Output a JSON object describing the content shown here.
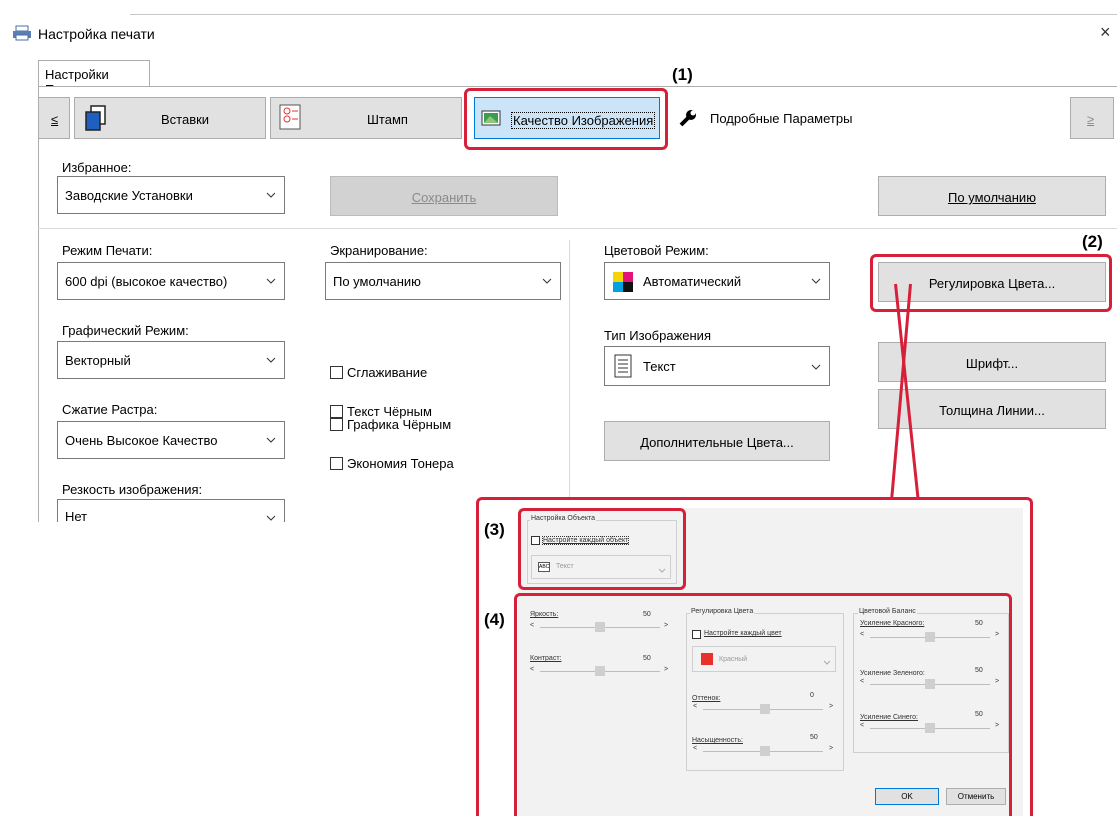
{
  "window": {
    "title": "Настройка печати",
    "close_glyph": "×"
  },
  "tab": {
    "label": "Настройки Печати"
  },
  "pager": {
    "prev": "≤",
    "next": "≥"
  },
  "page_buttons": [
    {
      "label": "Вставки",
      "icon": "inserts-icon"
    },
    {
      "label": "Штамп",
      "icon": "stamp-icon"
    },
    {
      "label": "Качество Изображения",
      "icon": "image-quality-icon"
    },
    {
      "label": "Подробные Параметры",
      "icon": "wrench-icon"
    }
  ],
  "favorites": {
    "label": "Избранное:",
    "value": "Заводские Установки",
    "save": "Сохранить",
    "default": "По умолчанию"
  },
  "print_mode": {
    "label": "Режим Печати:",
    "value": "600 dpi (высокое качество)"
  },
  "screening": {
    "label": "Экранирование:",
    "value": "По умолчанию"
  },
  "color_mode": {
    "label": "Цветовой Режим:",
    "value": "Автоматический"
  },
  "graphic_mode": {
    "label": "Графический Режим:",
    "value": "Векторный"
  },
  "image_type": {
    "label": "Тип Изображения",
    "value": "Текст"
  },
  "raster": {
    "label": "Сжатие Растра:",
    "value": "Очень Высокое Качество"
  },
  "sharpness": {
    "label": "Резкость изображения:",
    "value": "Нет"
  },
  "checks": [
    "Сглаживание",
    "Текст Чёрным",
    "Графика Чёрным",
    "Экономия Тонера"
  ],
  "extra_colors": "Дополнительные Цвета...",
  "side_buttons": {
    "color_adjust": "Регулировка Цвета...",
    "font": "Шрифт...",
    "line_width": "Толщина Линии..."
  },
  "callouts": [
    "(1)",
    "(2)",
    "(3)",
    "(4)"
  ],
  "inset": {
    "object_group": "Настройка Объекта",
    "object_check": "Настройте каждый объект",
    "object_value": "Текст",
    "object_icon_text": "ABC",
    "brightness": {
      "label": "Яркость:",
      "value": "50"
    },
    "contrast": {
      "label": "Контраст:",
      "value": "50"
    },
    "color_adjust_group": "Регулировка Цвета",
    "each_color_check": "Настройте каждый цвет",
    "color_value": "Красный",
    "hue": {
      "label": "Оттенок:",
      "value": "0"
    },
    "saturation": {
      "label": "Насыщенность:",
      "value": "50"
    },
    "balance_group": "Цветовой Баланс",
    "red_gain": {
      "label": "Усиление Красного:",
      "value": "50"
    },
    "green_gain": {
      "label": "Усиление Зеленого:",
      "value": "50"
    },
    "blue_gain": {
      "label": "Усиление Синего:",
      "value": "50"
    },
    "arrow_left": "<",
    "arrow_right": ">",
    "ok": "OK",
    "cancel": "Отменить"
  },
  "colors": {
    "accent": "#d6203a",
    "selected_tab": "#cce4f7"
  }
}
